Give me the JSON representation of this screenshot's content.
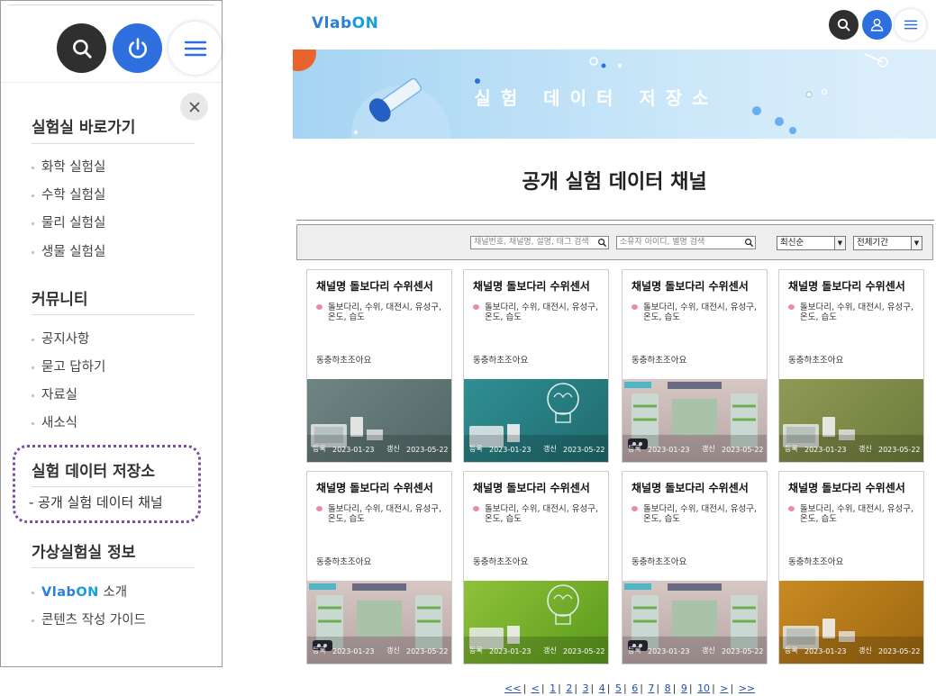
{
  "left_panel": {
    "sections": [
      {
        "title": "실험실 바로가기",
        "items": [
          "화학 실험실",
          "수학 실험실",
          "물리 실험실",
          "생물 실험실"
        ]
      },
      {
        "title": "커뮤니티",
        "items": [
          "공지사항",
          "묻고 답하기",
          "자료실",
          "새소식"
        ]
      },
      {
        "title": "실험 데이터 저장소",
        "items": [
          "- 공개 실험 데이터 채널"
        ]
      },
      {
        "title": "가상실험실 정보",
        "items": [
          "소개",
          "콘텐츠 작성 가이드"
        ]
      }
    ],
    "logo_text_a": "Vlab",
    "logo_text_b": "ON"
  },
  "header": {
    "logo_a": "Vlab",
    "logo_b": "ON"
  },
  "banner": {
    "title": "실험 데이터 저장소"
  },
  "page": {
    "title": "공개 실험 데이터 채널"
  },
  "filters": {
    "search_placeholder": "채널번호, 채널명, 설명, 태그 검색",
    "owner_placeholder": "소유자 아이디, 별명 검색",
    "sort_value": "최신순",
    "period_value": "전체기간"
  },
  "cards": [
    {
      "title": "채널명 돌보다리 수위센서",
      "tags": "돌보다리, 수위, 대전시, 유성구, 온도, 습도",
      "desc": "동충하초조아요",
      "reg_label": "등록",
      "reg_date": "2023-01-23",
      "upd_label": "갱신",
      "upd_date": "2023-05-22",
      "image": "laptop-slate"
    },
    {
      "title": "채널명 돌보다리 수위센서",
      "tags": "돌보다리, 수위, 대전시, 유성구, 온도, 습도",
      "desc": "동충하초조아요",
      "reg_label": "등록",
      "reg_date": "2023-01-23",
      "upd_label": "갱신",
      "upd_date": "2023-05-22",
      "image": "bulb-teal"
    },
    {
      "title": "채널명 돌보다리 수위센서",
      "tags": "돌보다리, 수위, 대전시, 유성구, 온도, 습도",
      "desc": "동충하초조아요",
      "reg_label": "등록",
      "reg_date": "2023-01-23",
      "upd_label": "갱신",
      "upd_date": "2023-05-22",
      "image": "lab-room"
    },
    {
      "title": "채널명 돌보다리 수위센서",
      "tags": "돌보다리, 수위, 대전시, 유성구, 온도, 습도",
      "desc": "동충하초조아요",
      "reg_label": "등록",
      "reg_date": "2023-01-23",
      "upd_label": "갱신",
      "upd_date": "2023-05-22",
      "image": "laptop-olive"
    },
    {
      "title": "채널명 돌보다리 수위센서",
      "tags": "돌보다리, 수위, 대전시, 유성구, 온도, 습도",
      "desc": "동충하초조아요",
      "reg_label": "등록",
      "reg_date": "2023-01-23",
      "upd_label": "갱신",
      "upd_date": "2023-05-22",
      "image": "lab-room"
    },
    {
      "title": "채널명 돌보다리 수위센서",
      "tags": "돌보다리, 수위, 대전시, 유성구, 온도, 습도",
      "desc": "동충하초조아요",
      "reg_label": "등록",
      "reg_date": "2023-01-23",
      "upd_label": "갱신",
      "upd_date": "2023-05-22",
      "image": "bulb-green"
    },
    {
      "title": "채널명 돌보다리 수위센서",
      "tags": "돌보다리, 수위, 대전시, 유성구, 온도, 습도",
      "desc": "동충하초조아요",
      "reg_label": "등록",
      "reg_date": "2023-01-23",
      "upd_label": "갱신",
      "upd_date": "2023-05-22",
      "image": "lab-room"
    },
    {
      "title": "채널명 돌보다리 수위센서",
      "tags": "돌보다리, 수위, 대전시, 유성구, 온도, 습도",
      "desc": "동충하초조아요",
      "reg_label": "등록",
      "reg_date": "2023-01-23",
      "upd_label": "갱신",
      "upd_date": "2023-05-22",
      "image": "laptop-orange"
    }
  ],
  "pagination": {
    "first": "<<",
    "prev": "<",
    "pages": [
      "1",
      "2",
      "3",
      "4",
      "5",
      "6",
      "7",
      "8",
      "9",
      "10"
    ],
    "next": ">",
    "last": ">>"
  },
  "colors": {
    "accent_blue": "#2e6fe0",
    "dark_button": "#2f2f2f",
    "highlight_box": "#7a4fa1",
    "tag_dot": "#e58ab0"
  }
}
